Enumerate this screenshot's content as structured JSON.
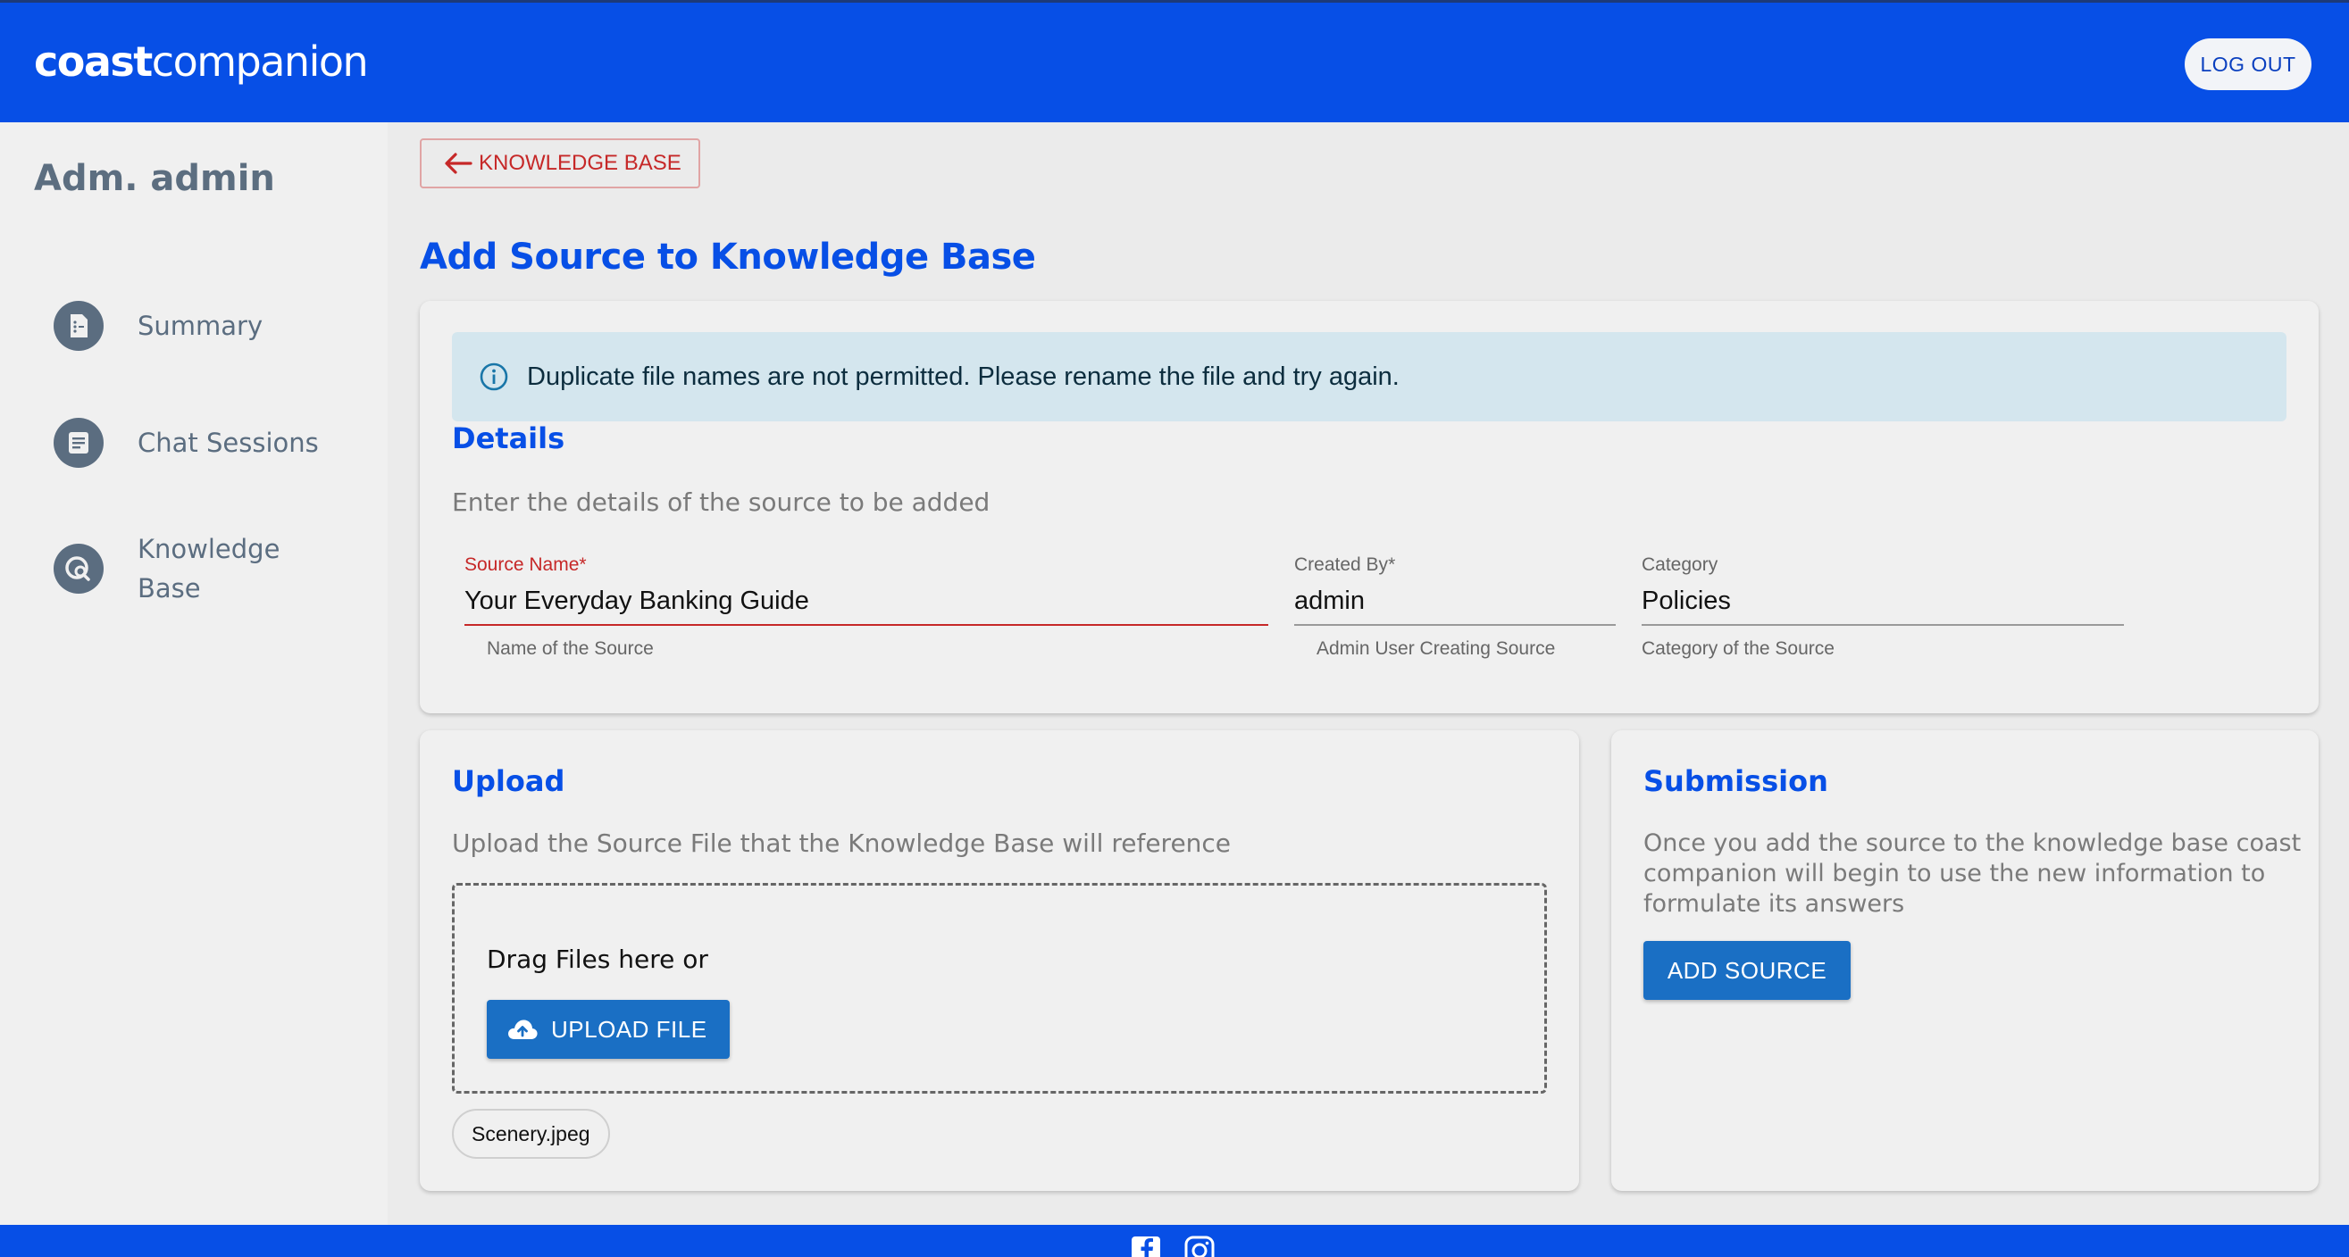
{
  "header": {
    "logo_bold": "coast",
    "logo_light": "companion",
    "logout_label": "LOG OUT"
  },
  "sidebar": {
    "user_name": "Adm. admin",
    "items": [
      {
        "label": "Summary",
        "icon": "summary-document-icon"
      },
      {
        "label": "Chat Sessions",
        "icon": "chat-list-icon"
      },
      {
        "label": "Knowledge Base",
        "icon": "knowledge-search-icon"
      }
    ]
  },
  "main": {
    "back_label": "KNOWLEDGE BASE",
    "page_title": "Add Source to Knowledge Base",
    "alert": "Duplicate file names are not permitted. Please rename the file and try again.",
    "details": {
      "title": "Details",
      "subtitle": "Enter the details of the source to be added",
      "source_name": {
        "label": "Source Name",
        "required": "*",
        "value": "Your Everyday Banking Guide",
        "helper": "Name of the Source"
      },
      "created_by": {
        "label": "Created By",
        "required": "*",
        "value": "admin",
        "helper": "Admin User Creating Source"
      },
      "category": {
        "label": "Category",
        "value": "Policies",
        "helper": "Category of the Source"
      }
    },
    "upload": {
      "title": "Upload",
      "subtitle": "Upload the Source File that the Knowledge Base will reference",
      "drag_text": "Drag Files here or",
      "button_label": "UPLOAD FILE",
      "file_chip": "Scenery.jpeg"
    },
    "submission": {
      "title": "Submission",
      "text": "Once you add the source to the knowledge base coast companion will begin to use the new information to formulate its answers",
      "button_label": "ADD SOURCE"
    }
  },
  "colors": {
    "brand_blue": "#074fe6",
    "button_blue": "#1a6fc4",
    "error_red": "#c62828",
    "alert_bg": "#d4e6ee"
  }
}
